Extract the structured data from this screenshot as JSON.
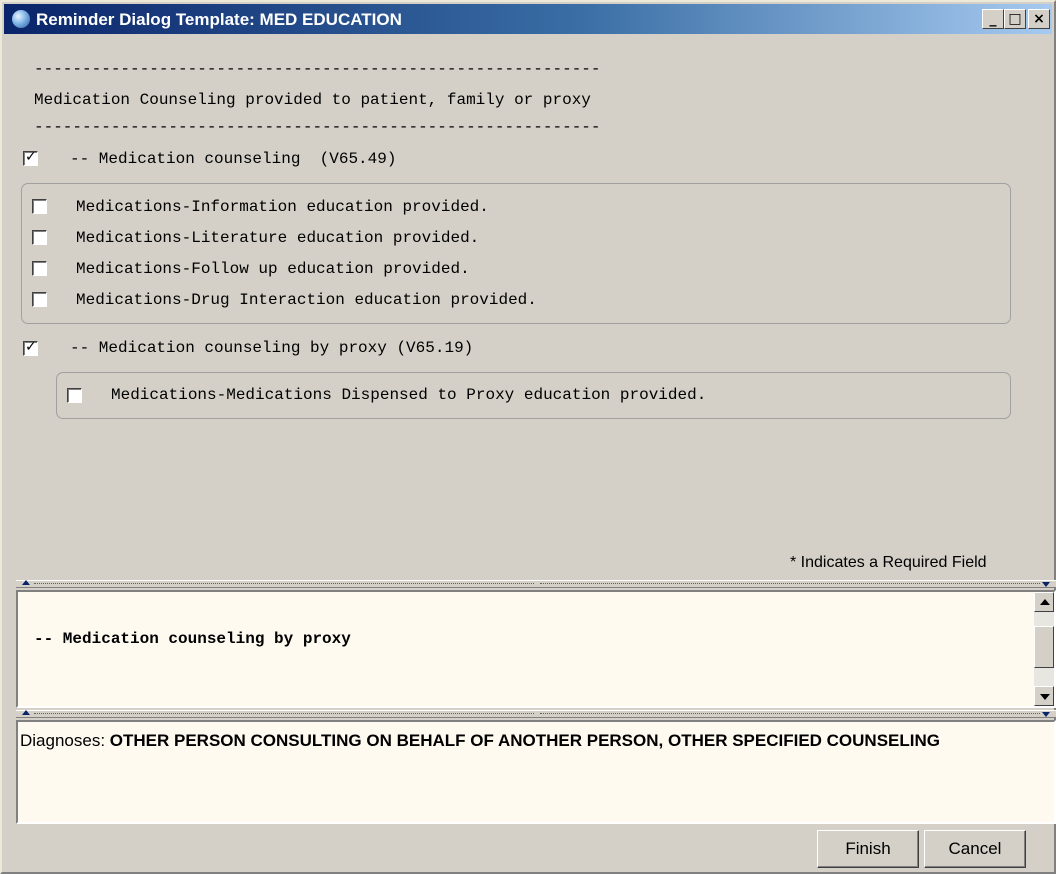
{
  "window": {
    "title": "Reminder Dialog Template: MED EDUCATION",
    "controls": {
      "minimize": "_",
      "maximize": "□",
      "close": "×"
    }
  },
  "header": {
    "divider_top": "-----------------------------------------------------------",
    "text": "Medication Counseling provided to patient, family or proxy",
    "divider_bottom": "-----------------------------------------------------------"
  },
  "sections": [
    {
      "label": "-- Medication counseling  (V65.49)",
      "checked": true,
      "items": [
        {
          "label": "Medications-Information education provided.",
          "checked": false
        },
        {
          "label": "Medications-Literature education provided.",
          "checked": false
        },
        {
          "label": "Medications-Follow up education provided.",
          "checked": false
        },
        {
          "label": "Medications-Drug Interaction education provided.",
          "checked": false
        }
      ]
    },
    {
      "label": "-- Medication counseling by proxy (V65.19)",
      "checked": true,
      "items": [
        {
          "label": "Medications-Medications Dispensed to Proxy education provided.",
          "checked": false
        }
      ]
    }
  ],
  "required_note": "* Indicates a Required Field",
  "preview": {
    "text": "-- Medication counseling by proxy"
  },
  "diagnoses": {
    "label": "Diagnoses: ",
    "value": "OTHER PERSON CONSULTING ON BEHALF OF ANOTHER PERSON, OTHER SPECIFIED COUNSELING"
  },
  "buttons": {
    "finish": "Finish",
    "cancel": "Cancel"
  }
}
